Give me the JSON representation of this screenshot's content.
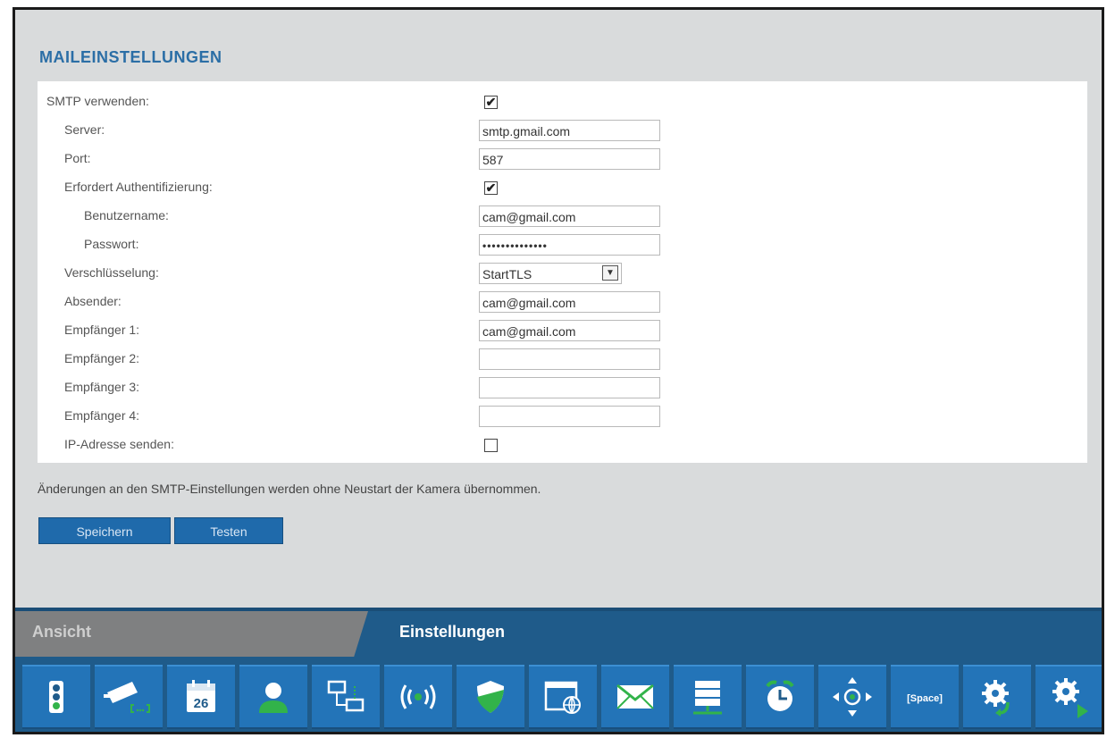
{
  "page_title": "MAILEINSTELLUNGEN",
  "form": {
    "smtp_label": "SMTP verwenden:",
    "smtp_checked": "✔",
    "server_label": "Server:",
    "server_value": "smtp.gmail.com",
    "port_label": "Port:",
    "port_value": "587",
    "auth_label": "Erfordert Authentifizierung:",
    "auth_checked": "✔",
    "username_label": "Benutzername:",
    "username_value": "cam@gmail.com",
    "password_label": "Passwort:",
    "password_value": "••••••••••••••",
    "encryption_label": "Verschlüsselung:",
    "encryption_value": "StartTLS",
    "sender_label": "Absender:",
    "sender_value": "cam@gmail.com",
    "recipient1_label": "Empfänger 1:",
    "recipient1_value": "cam@gmail.com",
    "recipient2_label": "Empfänger 2:",
    "recipient2_value": "",
    "recipient3_label": "Empfänger 3:",
    "recipient3_value": "",
    "recipient4_label": "Empfänger 4:",
    "recipient4_value": "",
    "ip_label": "IP-Adresse senden:",
    "ip_checked": ""
  },
  "note": "Änderungen an den SMTP-Einstellungen werden ohne Neustart der Kamera übernommen.",
  "buttons": {
    "save": "Speichern",
    "test": "Testen"
  },
  "tabs": {
    "view": "Ansicht",
    "settings": "Einstellungen"
  },
  "toolbar": {
    "calendar_day": "26",
    "space_label": "[Space]",
    "icons": [
      "status-light-icon",
      "camera-icon",
      "calendar-icon",
      "user-icon",
      "network-icon",
      "wireless-icon",
      "shield-icon",
      "web-icon",
      "mail-icon",
      "storage-icon",
      "alarm-clock-icon",
      "ptz-icon",
      "space-icon",
      "settings-restore-icon",
      "settings-run-icon"
    ]
  },
  "colors": {
    "accent": "#1f6aab",
    "title": "#2b6ea6",
    "bar": "#1f5b8a",
    "icon_bg": "#2374b8",
    "icon_green": "#32b34a"
  }
}
